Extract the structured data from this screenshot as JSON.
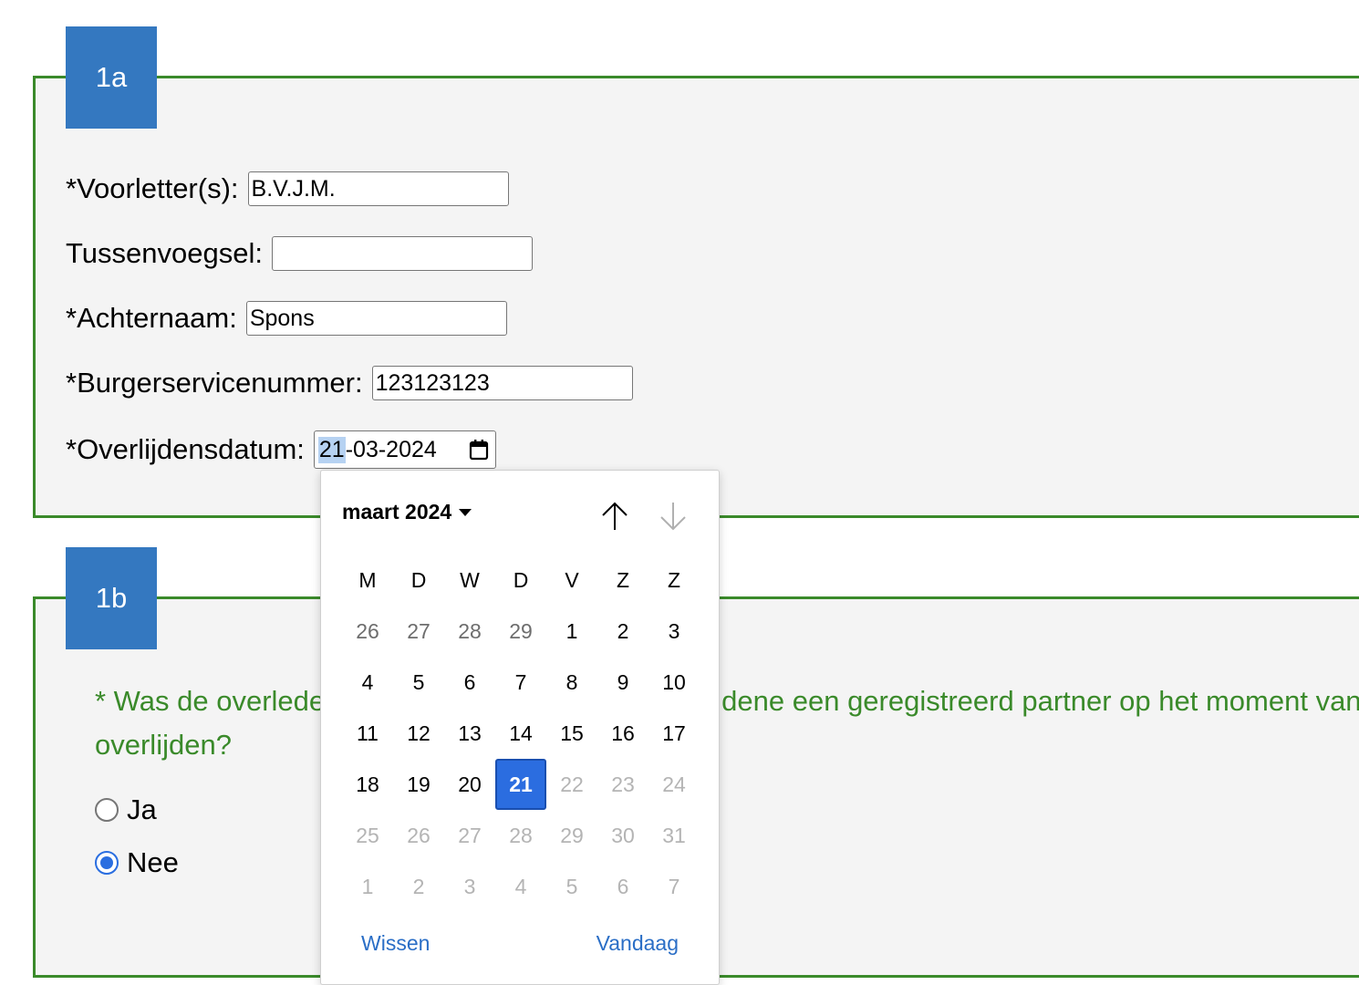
{
  "section_1a": {
    "legend": "1a",
    "fields": {
      "voorletters": {
        "label": "*Voorletter(s):",
        "value": "B.V.J.M."
      },
      "tussenvoegsel": {
        "label": "Tussenvoegsel:",
        "value": ""
      },
      "achternaam": {
        "label": "*Achternaam:",
        "value": "Spons"
      },
      "bsn": {
        "label": "*Burgerservicenummer:",
        "value": "123123123"
      },
      "overlijdensdatum": {
        "label": "*Overlijdensdatum:",
        "day": "21",
        "rest": "-03-2024"
      }
    }
  },
  "section_1b": {
    "legend": "1b",
    "question_line1": "* Was de overlede",
    "question_line1_end": "dene een geregistreerd partner op het moment van",
    "question_line2": "overlijden?",
    "options": {
      "ja": "Ja",
      "nee": "Nee"
    },
    "selected": "nee"
  },
  "datepicker": {
    "month_label": "maart 2024",
    "weekdays": [
      "M",
      "D",
      "W",
      "D",
      "V",
      "Z",
      "Z"
    ],
    "weeks": [
      [
        [
          "26",
          "muted"
        ],
        [
          "27",
          "muted"
        ],
        [
          "28",
          "muted"
        ],
        [
          "29",
          "muted"
        ],
        [
          "1",
          ""
        ],
        [
          "2",
          ""
        ],
        [
          "3",
          ""
        ]
      ],
      [
        [
          "4",
          ""
        ],
        [
          "5",
          ""
        ],
        [
          "6",
          ""
        ],
        [
          "7",
          ""
        ],
        [
          "8",
          ""
        ],
        [
          "9",
          ""
        ],
        [
          "10",
          ""
        ]
      ],
      [
        [
          "11",
          ""
        ],
        [
          "12",
          ""
        ],
        [
          "13",
          ""
        ],
        [
          "14",
          ""
        ],
        [
          "15",
          ""
        ],
        [
          "16",
          ""
        ],
        [
          "17",
          ""
        ]
      ],
      [
        [
          "18",
          ""
        ],
        [
          "19",
          ""
        ],
        [
          "20",
          ""
        ],
        [
          "21",
          "selected"
        ],
        [
          "22",
          "disabled"
        ],
        [
          "23",
          "disabled"
        ],
        [
          "24",
          "disabled"
        ]
      ],
      [
        [
          "25",
          "disabled"
        ],
        [
          "26",
          "disabled"
        ],
        [
          "27",
          "disabled"
        ],
        [
          "28",
          "disabled"
        ],
        [
          "29",
          "disabled"
        ],
        [
          "30",
          "disabled"
        ],
        [
          "31",
          "disabled"
        ]
      ],
      [
        [
          "1",
          "disabled"
        ],
        [
          "2",
          "disabled"
        ],
        [
          "3",
          "disabled"
        ],
        [
          "4",
          "disabled"
        ],
        [
          "5",
          "disabled"
        ],
        [
          "6",
          "disabled"
        ],
        [
          "7",
          "disabled"
        ]
      ]
    ],
    "clear_label": "Wissen",
    "today_label": "Vandaag"
  },
  "colors": {
    "legend_bg": "#3478c0",
    "border_green": "#3a8a2a",
    "selected_blue": "#2b6de0",
    "link_blue": "#2a6ec6"
  }
}
